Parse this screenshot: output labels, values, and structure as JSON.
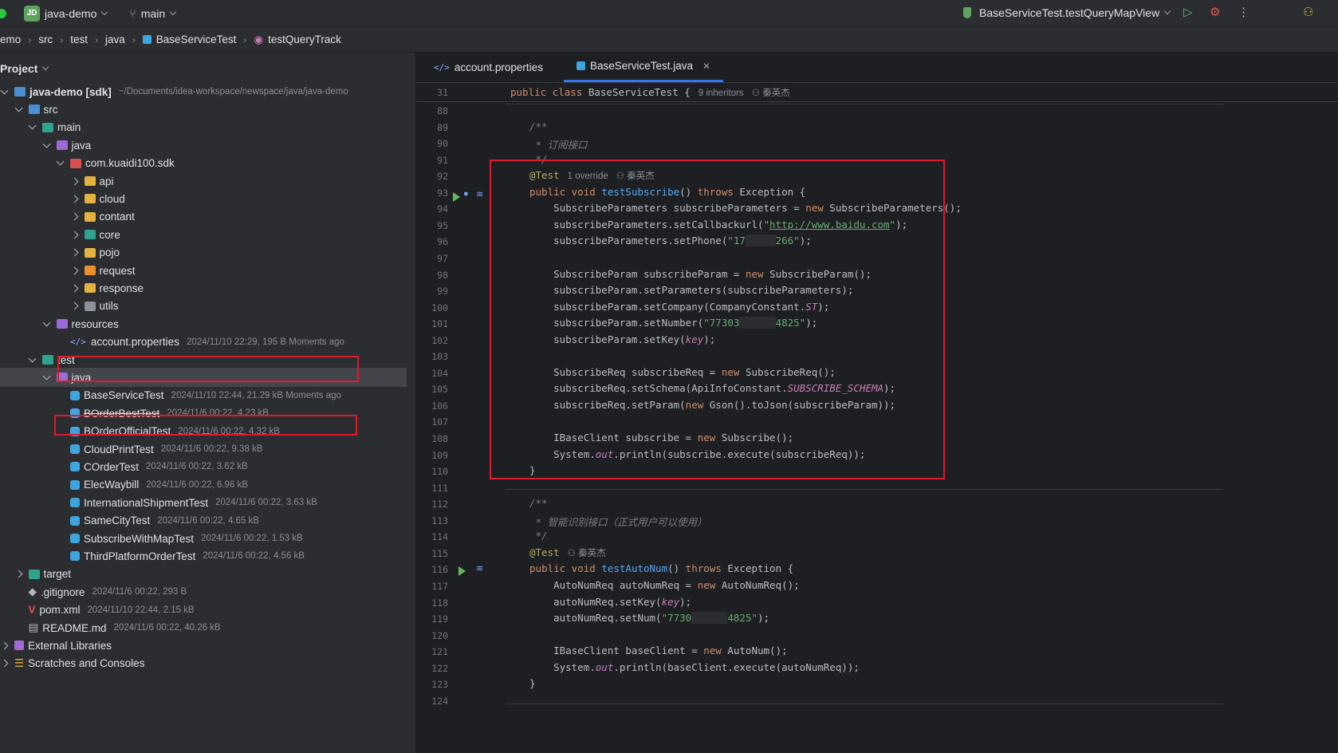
{
  "titlebar": {
    "project_badge": "JD",
    "project_name": "java-demo",
    "branch": "main",
    "run_config": "BaseServiceTest.testQueryMapView",
    "icons": [
      "run-icon",
      "debug-icon",
      "more-icon",
      "people-icon"
    ]
  },
  "breadcrumb": [
    "emo",
    "src",
    "test",
    "java",
    "BaseServiceTest",
    "testQueryTrack"
  ],
  "project": {
    "title": "Project",
    "tree": [
      {
        "label": "java-demo [sdk]",
        "meta": "~/Documents/idea-workspace/newspace/java/java-demo",
        "indent": 0,
        "arrow": "down",
        "icon": "folder-blue"
      },
      {
        "label": "src",
        "meta": "",
        "indent": 1,
        "arrow": "down",
        "icon": "folder-blue"
      },
      {
        "label": "main",
        "meta": "",
        "indent": 2,
        "arrow": "down",
        "icon": "folder-teal"
      },
      {
        "label": "java",
        "meta": "",
        "indent": 3,
        "arrow": "down",
        "icon": "folder-purple"
      },
      {
        "label": "com.kuaidi100.sdk",
        "meta": "",
        "indent": 4,
        "arrow": "down",
        "icon": "folder-red"
      },
      {
        "label": "api",
        "meta": "",
        "indent": 5,
        "arrow": "right",
        "icon": "folder"
      },
      {
        "label": "cloud",
        "meta": "",
        "indent": 5,
        "arrow": "right",
        "icon": "folder"
      },
      {
        "label": "contant",
        "meta": "",
        "indent": 5,
        "arrow": "right",
        "icon": "folder"
      },
      {
        "label": "core",
        "meta": "",
        "indent": 5,
        "arrow": "right",
        "icon": "folder-teal"
      },
      {
        "label": "pojo",
        "meta": "",
        "indent": 5,
        "arrow": "right",
        "icon": "folder"
      },
      {
        "label": "request",
        "meta": "",
        "indent": 5,
        "arrow": "right",
        "icon": "folder-orange"
      },
      {
        "label": "response",
        "meta": "",
        "indent": 5,
        "arrow": "right",
        "icon": "folder"
      },
      {
        "label": "utils",
        "meta": "",
        "indent": 5,
        "arrow": "right",
        "icon": "folder-grey"
      },
      {
        "label": "resources",
        "meta": "",
        "indent": 3,
        "arrow": "down",
        "icon": "folder-purple"
      },
      {
        "label": "account.properties",
        "meta": "2024/11/10 22:29, 195 B Moments ago",
        "indent": 4,
        "arrow": "none",
        "icon": "code"
      },
      {
        "label": "test",
        "meta": "",
        "indent": 2,
        "arrow": "down",
        "icon": "folder-teal"
      },
      {
        "label": "java",
        "meta": "",
        "indent": 3,
        "arrow": "down",
        "icon": "folder-purple",
        "selected": true
      },
      {
        "label": "BaseServiceTest",
        "meta": "2024/11/10 22:44, 21.29 kB Moments ago",
        "indent": 4,
        "arrow": "none",
        "icon": "cls"
      },
      {
        "label": "BOrderBestTest",
        "meta": "2024/11/6 00:22, 4.23 kB",
        "indent": 4,
        "arrow": "none",
        "icon": "cls",
        "strike": true
      },
      {
        "label": "BOrderOfficialTest",
        "meta": "2024/11/6 00:22, 4.32 kB",
        "indent": 4,
        "arrow": "none",
        "icon": "cls"
      },
      {
        "label": "CloudPrintTest",
        "meta": "2024/11/6 00:22, 9.38 kB",
        "indent": 4,
        "arrow": "none",
        "icon": "cls"
      },
      {
        "label": "COrderTest",
        "meta": "2024/11/6 00:22, 3.62 kB",
        "indent": 4,
        "arrow": "none",
        "icon": "cls"
      },
      {
        "label": "ElecWaybill",
        "meta": "2024/11/6 00:22, 6.96 kB",
        "indent": 4,
        "arrow": "none",
        "icon": "cls"
      },
      {
        "label": "InternationalShipmentTest",
        "meta": "2024/11/6 00:22, 3.63 kB",
        "indent": 4,
        "arrow": "none",
        "icon": "cls"
      },
      {
        "label": "SameCityTest",
        "meta": "2024/11/6 00:22, 4.65 kB",
        "indent": 4,
        "arrow": "none",
        "icon": "cls"
      },
      {
        "label": "SubscribeWithMapTest",
        "meta": "2024/11/6 00:22, 1.53 kB",
        "indent": 4,
        "arrow": "none",
        "icon": "cls"
      },
      {
        "label": "ThirdPlatformOrderTest",
        "meta": "2024/11/6 00:22, 4.56 kB",
        "indent": 4,
        "arrow": "none",
        "icon": "cls"
      },
      {
        "label": "target",
        "meta": "",
        "indent": 1,
        "arrow": "right",
        "icon": "folder-teal"
      },
      {
        "label": ".gitignore",
        "meta": "2024/11/6 00:22, 293 B",
        "indent": 1,
        "arrow": "none",
        "icon": "git"
      },
      {
        "label": "pom.xml",
        "meta": "2024/11/10 22:44, 2.15 kB",
        "indent": 1,
        "arrow": "none",
        "icon": "maven"
      },
      {
        "label": "README.md",
        "meta": "2024/11/6 00:22, 40.26 kB",
        "indent": 1,
        "arrow": "none",
        "icon": "md"
      },
      {
        "label": "External Libraries",
        "meta": "",
        "indent": 0,
        "arrow": "right",
        "icon": "lib"
      },
      {
        "label": "Scratches and Consoles",
        "meta": "",
        "indent": 0,
        "arrow": "right",
        "icon": "scratch"
      }
    ]
  },
  "tabs": [
    {
      "label": "account.properties",
      "active": false
    },
    {
      "label": "BaseServiceTest.java",
      "active": true
    }
  ],
  "sticky": {
    "line": "31",
    "text_kw": "public class ",
    "text_cls": "BaseServiceTest {",
    "inheritors": "9 inheritors",
    "author": "秦英杰"
  },
  "code_lines": [
    {
      "n": "88",
      "html": ""
    },
    {
      "n": "89",
      "html": "<span class='cm'>/**</span>"
    },
    {
      "n": "90",
      "html": "<span class='cm'> * 订阅接口</span>"
    },
    {
      "n": "91",
      "html": "<span class='cm'> */</span>"
    },
    {
      "n": "92",
      "html": "<span class='ann'>@Test</span><span class='hint'>1 override</span><span class='hint'>&#9863; 秦英杰</span>"
    },
    {
      "n": "93",
      "html": "<span class='kw'>public void </span><span class='fn'>testSubscribe</span>() <span class='kw'>throws </span>Exception {"
    },
    {
      "n": "94",
      "html": "    SubscribeParameters subscribeParameters = <span class='kw'>new </span>SubscribeParameters();"
    },
    {
      "n": "95",
      "html": "    subscribeParameters.setCallbackurl(<span class='str'>\"<span class='url'>http://www.baidu.com</span>\"</span>);"
    },
    {
      "n": "96",
      "html": "    subscribeParameters.setPhone(<span class='str'>\"17<span class='redact'>xxxxx</span>266\"</span>);"
    },
    {
      "n": "97",
      "html": ""
    },
    {
      "n": "98",
      "html": "    SubscribeParam subscribeParam = <span class='kw'>new </span>SubscribeParam();"
    },
    {
      "n": "99",
      "html": "    subscribeParam.setParameters(subscribeParameters);"
    },
    {
      "n": "100",
      "html": "    subscribeParam.setCompany(CompanyConstant.<span class='it'>ST</span>);"
    },
    {
      "n": "101",
      "html": "    subscribeParam.setNumber(<span class='str'>\"77303<span class='redact'>xxxxxx</span>4825\"</span>);"
    },
    {
      "n": "102",
      "html": "    subscribeParam.setKey(<span class='it'>key</span>);"
    },
    {
      "n": "103",
      "html": ""
    },
    {
      "n": "104",
      "html": "    SubscribeReq subscribeReq = <span class='kw'>new </span>SubscribeReq();"
    },
    {
      "n": "105",
      "html": "    subscribeReq.setSchema(ApiInfoConstant.<span class='it'>SUBSCRIBE_SCHEMA</span>);"
    },
    {
      "n": "106",
      "html": "    subscribeReq.setParam(<span class='kw'>new </span>Gson().toJson(subscribeParam));"
    },
    {
      "n": "107",
      "html": ""
    },
    {
      "n": "108",
      "html": "    IBaseClient subscribe = <span class='kw'>new </span>Subscribe();"
    },
    {
      "n": "109",
      "html": "    System.<span class='it'>out</span>.println(subscribe.execute(subscribeReq));"
    },
    {
      "n": "110",
      "html": "}"
    },
    {
      "n": "111",
      "html": ""
    },
    {
      "n": "112",
      "html": "<span class='cm'>/**</span>"
    },
    {
      "n": "113",
      "html": "<span class='cm'> * 智能识别接口（正式用户可以使用）</span>"
    },
    {
      "n": "114",
      "html": "<span class='cm'> */</span>"
    },
    {
      "n": "115",
      "html": "<span class='ann'>@Test</span><span class='hint'>&#9863; 秦英杰</span>"
    },
    {
      "n": "116",
      "html": "<span class='kw'>public void </span><span class='fn'>testAutoNum</span>() <span class='kw'>throws </span>Exception {"
    },
    {
      "n": "117",
      "html": "    AutoNumReq autoNumReq = <span class='kw'>new </span>AutoNumReq();"
    },
    {
      "n": "118",
      "html": "    autoNumReq.setKey(<span class='it'>key</span>);"
    },
    {
      "n": "119",
      "html": "    autoNumReq.setNum(<span class='str'>\"7730<span class='redact'>xxxxxx</span>4825\"</span>);"
    },
    {
      "n": "120",
      "html": ""
    },
    {
      "n": "121",
      "html": "    IBaseClient baseClient = <span class='kw'>new </span>AutoNum();"
    },
    {
      "n": "122",
      "html": "    System.<span class='it'>out</span>.println(baseClient.execute(autoNumReq));"
    },
    {
      "n": "123",
      "html": "}"
    },
    {
      "n": "124",
      "html": ""
    }
  ]
}
